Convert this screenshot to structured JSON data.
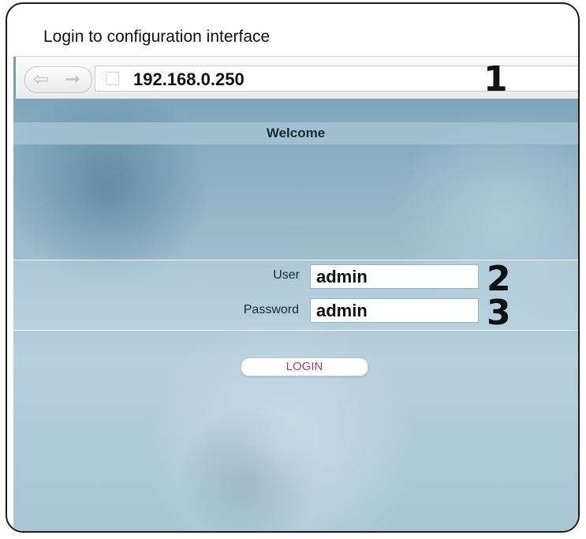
{
  "caption": "Login to configuration interface",
  "browser": {
    "back_icon": "back-arrow-icon",
    "forward_icon": "forward-arrow-icon",
    "url": "192.168.0.250"
  },
  "markers": {
    "url": "1",
    "user": "2",
    "password": "3"
  },
  "page": {
    "welcome": "Welcome",
    "user_label": "User",
    "user_value": "admin",
    "password_label": "Password",
    "password_value": "admin",
    "login_label": "LOGIN"
  },
  "colors": {
    "accent": "#6e9fc2",
    "login_text": "#a23b6f"
  }
}
